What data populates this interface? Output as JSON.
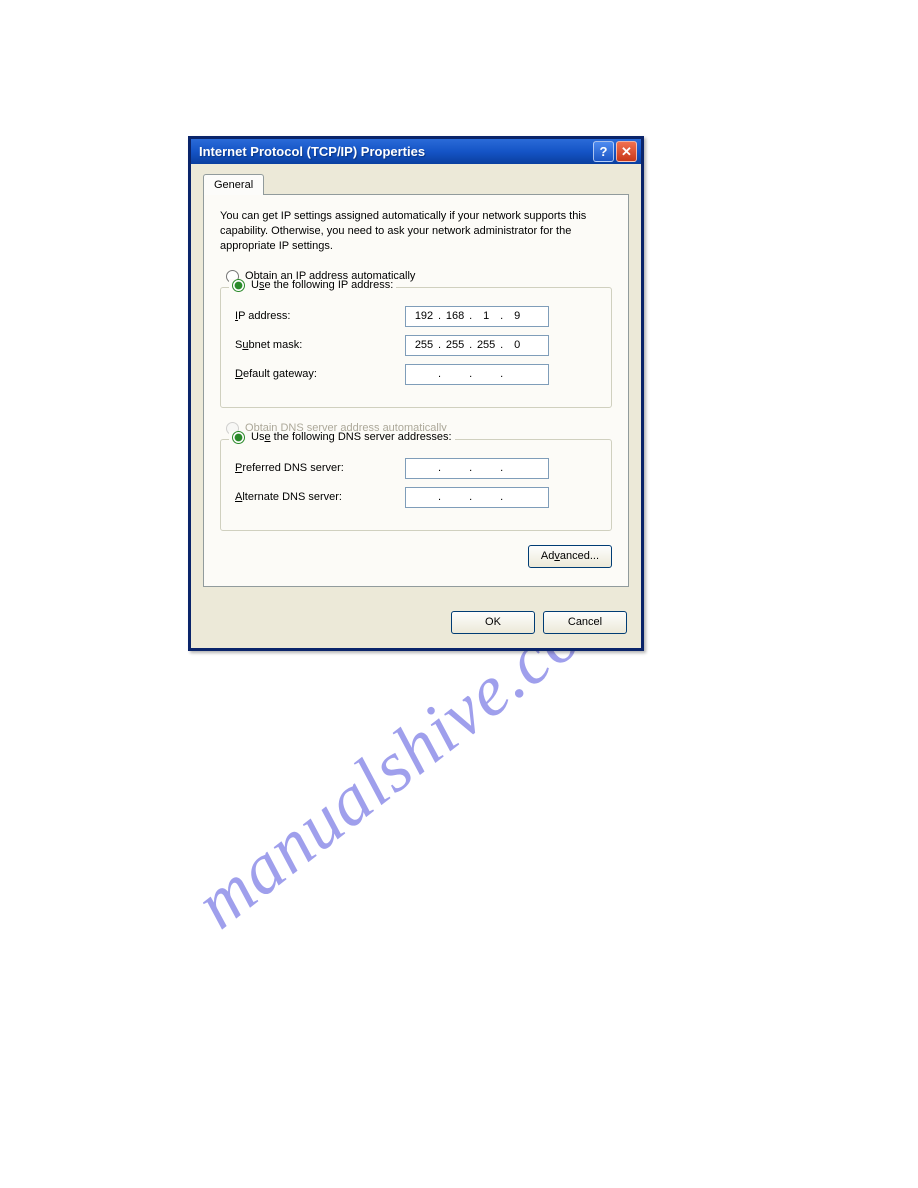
{
  "titlebar": {
    "title": "Internet Protocol (TCP/IP) Properties",
    "help_glyph": "?",
    "close_glyph": "✕"
  },
  "tabs": {
    "general": "General"
  },
  "intro": "You can get IP settings assigned automatically if your network supports this capability. Otherwise, you need to ask your network administrator for the appropriate IP settings.",
  "ip_section": {
    "auto_prefix": "O",
    "auto_rest": "btain an IP address automatically",
    "manual_prefix": "U",
    "manual_mid": "s",
    "manual_rest": "e the following IP address:",
    "ip_label_u": "I",
    "ip_label_rest": "P address:",
    "subnet_u": "u",
    "subnet_pre": "S",
    "subnet_rest": "bnet mask:",
    "gateway_u": "D",
    "gateway_rest": "efault gateway:",
    "ip": {
      "o1": "192",
      "o2": "168",
      "o3": "1",
      "o4": "9"
    },
    "subnet": {
      "o1": "255",
      "o2": "255",
      "o3": "255",
      "o4": "0"
    },
    "gateway": {
      "o1": "",
      "o2": "",
      "o3": "",
      "o4": ""
    }
  },
  "dns_section": {
    "auto_u": "b",
    "auto_pre": "O",
    "auto_rest": "tain DNS server address automatically",
    "manual_u": "e",
    "manual_pre": "Us",
    "manual_rest": " the following DNS server addresses:",
    "pref_u": "P",
    "pref_rest": "referred DNS server:",
    "alt_u": "A",
    "alt_rest": "lternate DNS server:",
    "preferred": {
      "o1": "",
      "o2": "",
      "o3": "",
      "o4": ""
    },
    "alternate": {
      "o1": "",
      "o2": "",
      "o3": "",
      "o4": ""
    }
  },
  "buttons": {
    "advanced_u": "v",
    "advanced_pre": "Ad",
    "advanced_rest": "anced...",
    "ok": "OK",
    "cancel": "Cancel"
  },
  "watermark": "manualshive.com"
}
